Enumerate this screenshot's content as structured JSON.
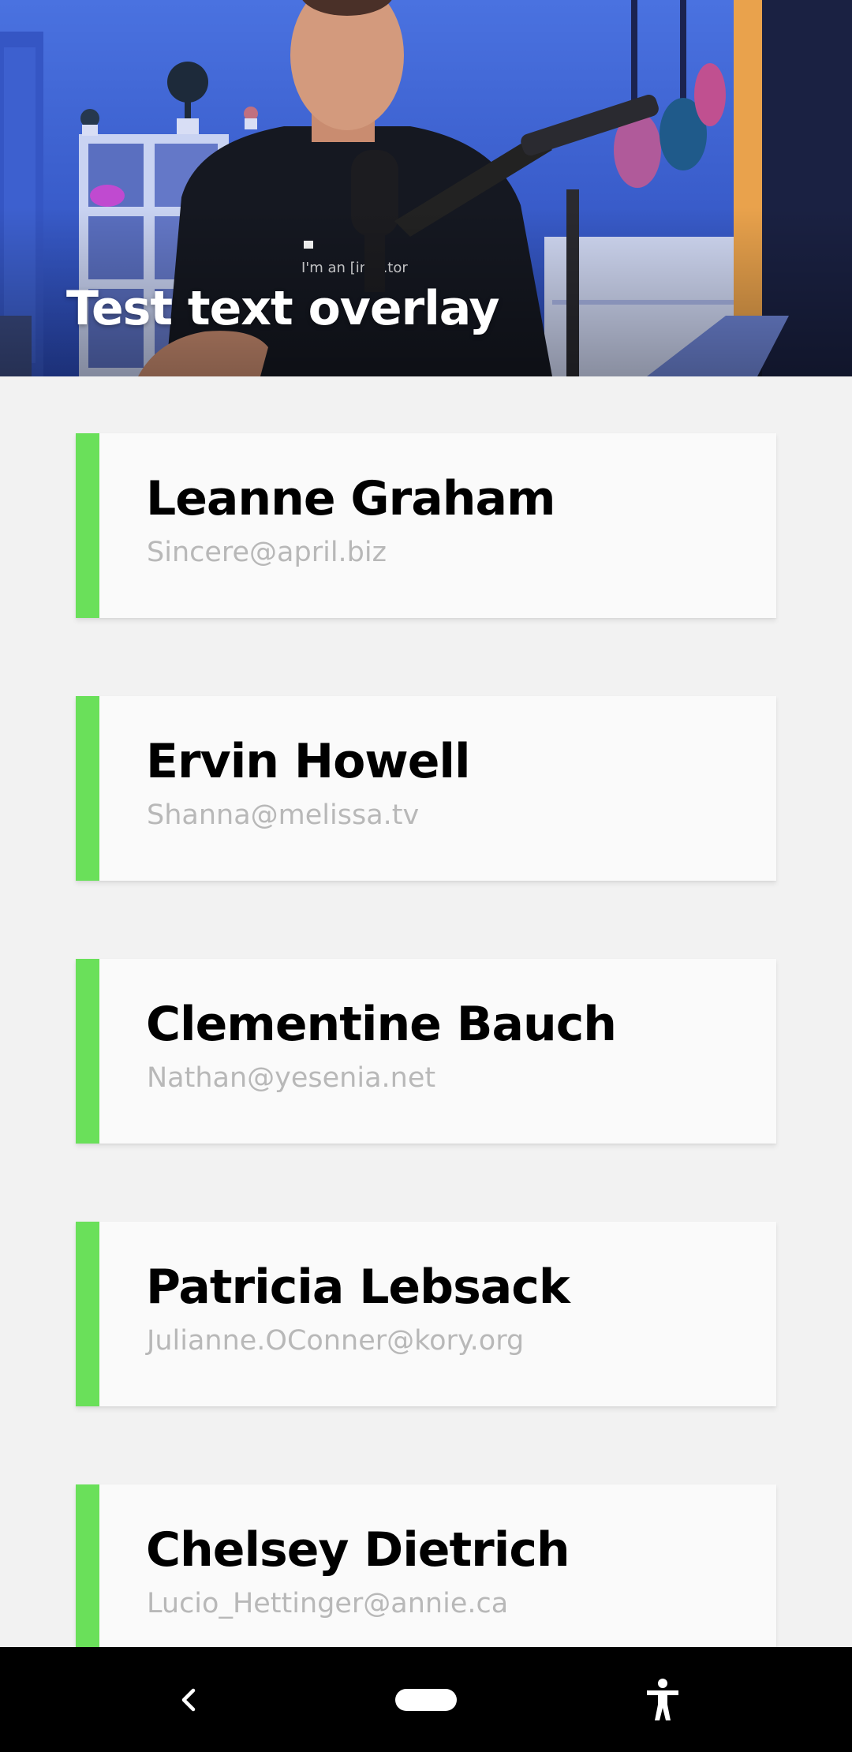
{
  "header": {
    "overlay_text": "Test text overlay",
    "image_description_icon": "video-still-image"
  },
  "users": [
    {
      "name": "Leanne Graham",
      "email": "Sincere@april.biz"
    },
    {
      "name": "Ervin Howell",
      "email": "Shanna@melissa.tv"
    },
    {
      "name": "Clementine Bauch",
      "email": "Nathan@yesenia.net"
    },
    {
      "name": "Patricia Lebsack",
      "email": "Julianne.OConner@kory.org"
    },
    {
      "name": "Chelsey Dietrich",
      "email": "Lucio_Hettinger@annie.ca"
    }
  ],
  "nav_bar": {
    "back_icon": "back-chevron-icon",
    "home_icon": "home-pill-icon",
    "accessibility_icon": "accessibility-icon"
  },
  "colors": {
    "accent": "#6ae05a",
    "background": "#f2f2f2",
    "card": "#fafafa",
    "name_text": "#000000",
    "email_text": "#b8b8b8",
    "nav_bar": "#000000"
  }
}
